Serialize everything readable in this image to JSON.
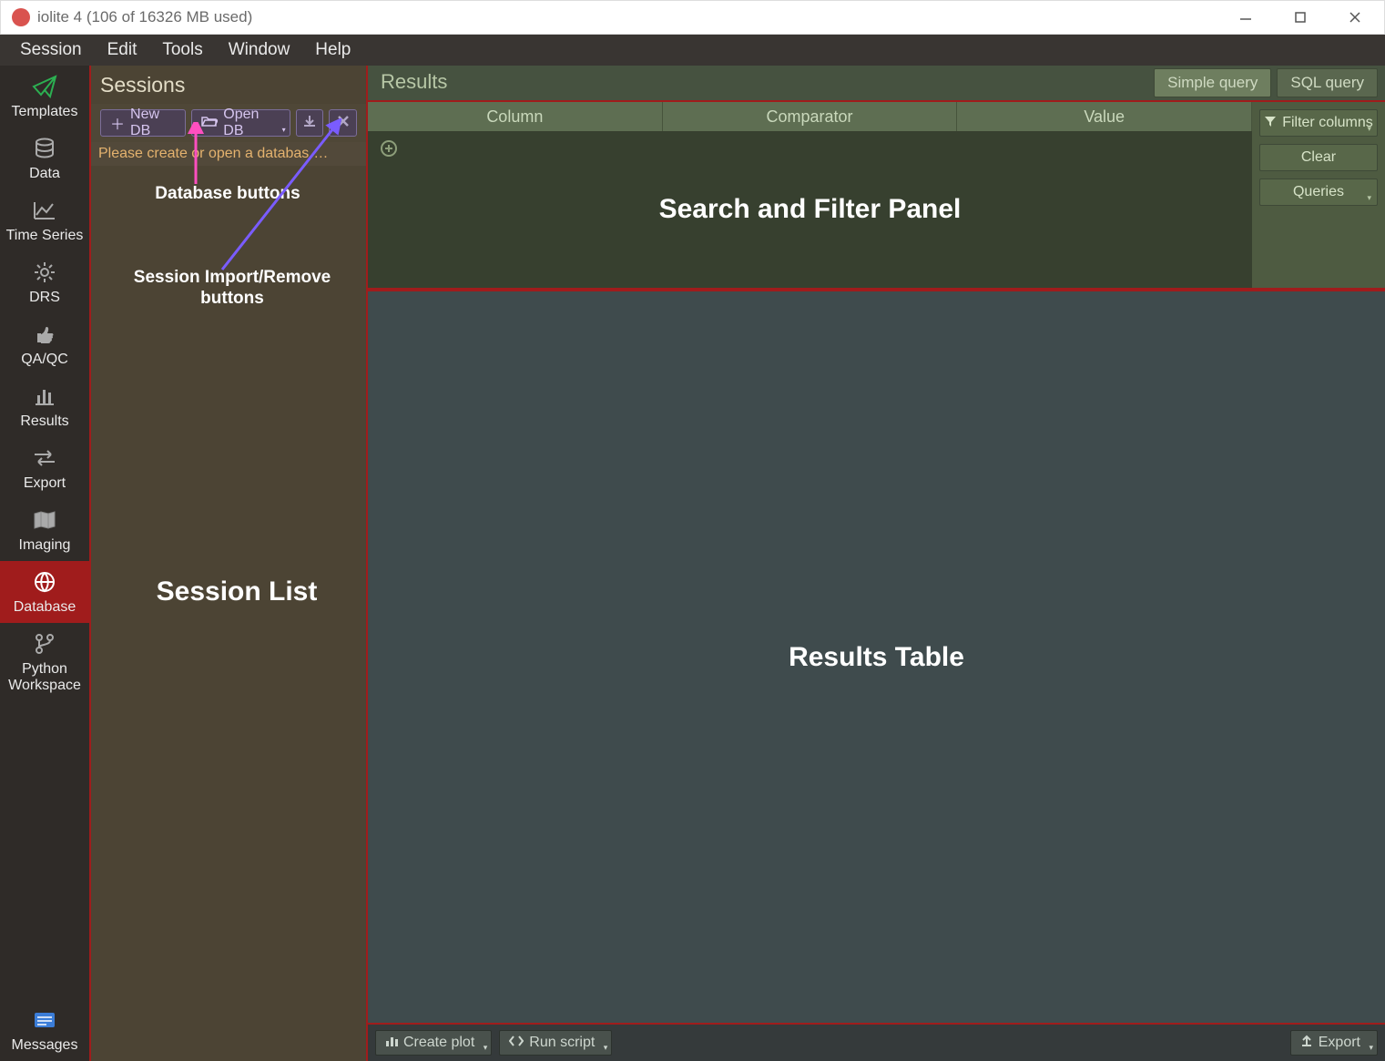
{
  "title": "iolite 4 (106 of 16326 MB used)",
  "menus": {
    "session": "Session",
    "edit": "Edit",
    "tools": "Tools",
    "window": "Window",
    "help": "Help"
  },
  "sidebar": {
    "items": [
      {
        "label": "Templates"
      },
      {
        "label": "Data"
      },
      {
        "label": "Time Series"
      },
      {
        "label": "DRS"
      },
      {
        "label": "QA/QC"
      },
      {
        "label": "Results"
      },
      {
        "label": "Export"
      },
      {
        "label": "Imaging"
      },
      {
        "label": "Database"
      },
      {
        "label": "Python Workspace"
      }
    ],
    "messages": "Messages"
  },
  "sessions": {
    "title": "Sessions",
    "newdb": "New DB",
    "opendb": "Open DB",
    "msg": "Please create or open a databas…."
  },
  "results": {
    "title": "Results",
    "tabs": {
      "simple": "Simple query",
      "sql": "SQL query"
    },
    "headers": {
      "column": "Column",
      "comparator": "Comparator",
      "value": "Value"
    },
    "buttons": {
      "filter": "Filter columns",
      "clear": "Clear",
      "queries": "Queries"
    },
    "footer": {
      "createplot": "Create plot",
      "runscript": "Run script",
      "export": "Export"
    }
  },
  "annotations": {
    "db_buttons": "Database buttons",
    "session_buttons_l1": "Session Import/Remove",
    "session_buttons_l2": "buttons",
    "session_list": "Session List",
    "search_panel": "Search and Filter Panel",
    "results_table": "Results Table"
  }
}
